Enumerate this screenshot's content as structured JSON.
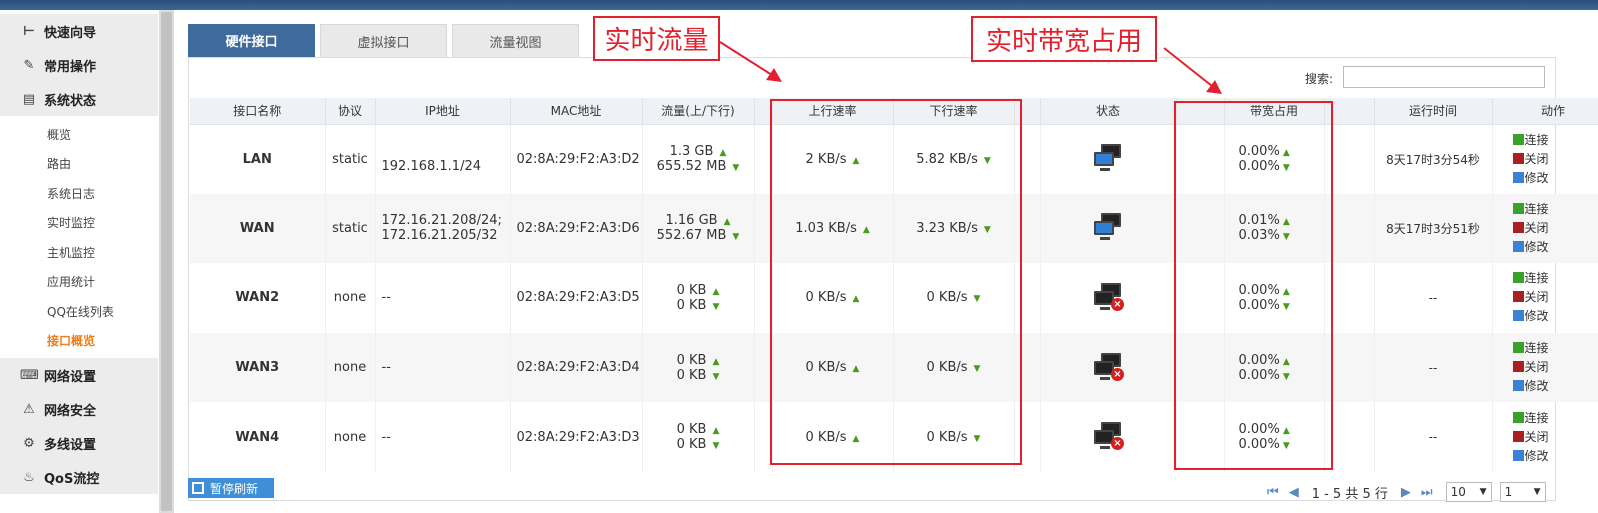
{
  "sidebar": {
    "groups": [
      {
        "icon": "signpost-icon",
        "glyph": "⊢",
        "label": "快速向导"
      },
      {
        "icon": "wrench-icon",
        "glyph": "✎",
        "label": "常用操作"
      },
      {
        "icon": "chart-icon",
        "glyph": "▤",
        "label": "系统状态"
      }
    ],
    "sub_items": [
      "概览",
      "路由",
      "系统日志",
      "实时监控",
      "主机监控",
      "应用统计",
      "QQ在线列表",
      "接口概览"
    ],
    "groups_after": [
      {
        "icon": "network-icon",
        "glyph": "⌨",
        "label": "网络设置"
      },
      {
        "icon": "security-icon",
        "glyph": "⚠",
        "label": "网络安全"
      },
      {
        "icon": "multiline-icon",
        "glyph": "⚙",
        "label": "多线设置"
      },
      {
        "icon": "qos-icon",
        "glyph": "♨",
        "label": "QoS流控"
      }
    ]
  },
  "tabs": [
    "硬件接口",
    "虚拟接口",
    "流量视图"
  ],
  "search": {
    "label": "搜索:",
    "value": ""
  },
  "annotations": {
    "traffic": "实时流量",
    "bandwidth": "实时带宽占用"
  },
  "columns": [
    "接口名称",
    "协议",
    "IP地址",
    "MAC地址",
    "流量(上/下行)",
    "上行速率",
    "下行速率",
    "状态",
    "带宽占用",
    "运行时间",
    "动作"
  ],
  "rows": [
    {
      "name": "LAN",
      "proto": "static",
      "ip1": "192.168.1.1/24",
      "ip2": "",
      "mac": "02:8A:29:F2:A3:D2",
      "up_traffic": "1.3 GB",
      "down_traffic": "655.52 MB",
      "up_rate": "2 KB/s",
      "down_rate": "5.82 KB/s",
      "status": "connected",
      "bw_up": "0.00%",
      "bw_down": "0.00%",
      "uptime": "8天17时3分54秒"
    },
    {
      "name": "WAN",
      "proto": "static",
      "ip1": "172.16.21.208/24;",
      "ip2": "172.16.21.205/32",
      "mac": "02:8A:29:F2:A3:D6",
      "up_traffic": "1.16 GB",
      "down_traffic": "552.67 MB",
      "up_rate": "1.03 KB/s",
      "down_rate": "3.23 KB/s",
      "status": "connected",
      "bw_up": "0.01%",
      "bw_down": "0.03%",
      "uptime": "8天17时3分51秒"
    },
    {
      "name": "WAN2",
      "proto": "none",
      "ip1": "--",
      "ip2": "",
      "mac": "02:8A:29:F2:A3:D5",
      "up_traffic": "0 KB",
      "down_traffic": "0 KB",
      "up_rate": "0 KB/s",
      "down_rate": "0 KB/s",
      "status": "disconnected",
      "bw_up": "0.00%",
      "bw_down": "0.00%",
      "uptime": "--"
    },
    {
      "name": "WAN3",
      "proto": "none",
      "ip1": "--",
      "ip2": "",
      "mac": "02:8A:29:F2:A3:D4",
      "up_traffic": "0 KB",
      "down_traffic": "0 KB",
      "up_rate": "0 KB/s",
      "down_rate": "0 KB/s",
      "status": "disconnected",
      "bw_up": "0.00%",
      "bw_down": "0.00%",
      "uptime": "--"
    },
    {
      "name": "WAN4",
      "proto": "none",
      "ip1": "--",
      "ip2": "",
      "mac": "02:8A:29:F2:A3:D3",
      "up_traffic": "0 KB",
      "down_traffic": "0 KB",
      "up_rate": "0 KB/s",
      "down_rate": "0 KB/s",
      "status": "disconnected",
      "bw_up": "0.00%",
      "bw_down": "0.00%",
      "uptime": "--"
    }
  ],
  "actions": {
    "connect": "连接",
    "close": "关闭",
    "edit": "修改"
  },
  "arrows": {
    "up": "▲",
    "down": "▼"
  },
  "pause_label": "暂停刷新",
  "pager": {
    "range": "1 - 5 共 5 行",
    "page_size": "10",
    "page": "1",
    "first": "⏮",
    "prev": "◀",
    "next": "▶",
    "last": "⏭",
    "caret": "▼"
  },
  "colors": {
    "accent": "#3f6a9c",
    "annotation": "#e5202e",
    "active_menu": "#f07d1a",
    "arrow_green": "#4a9a1c"
  }
}
